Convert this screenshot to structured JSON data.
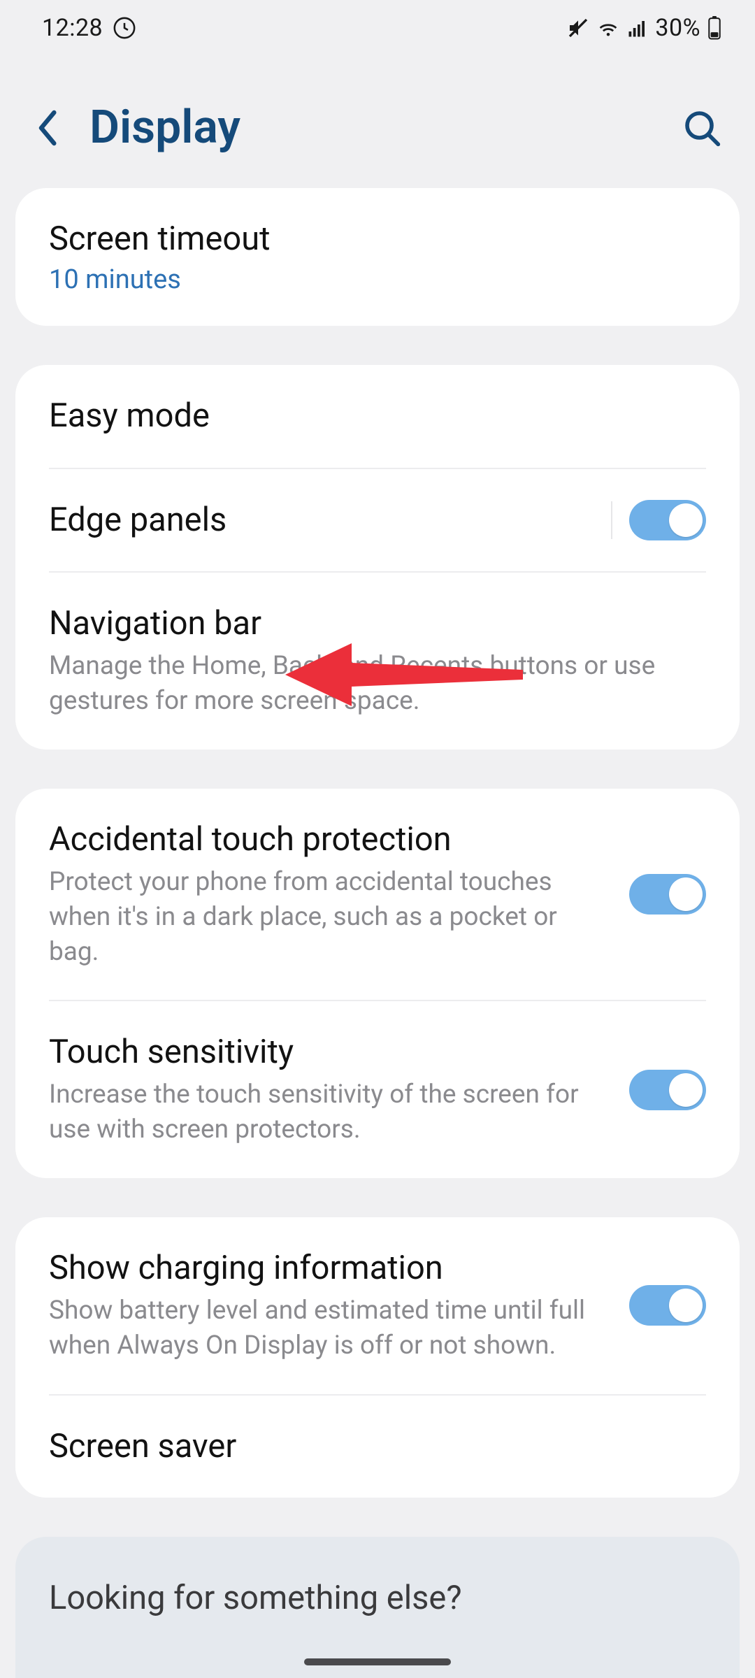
{
  "status": {
    "time": "12:28",
    "battery_text": "30%"
  },
  "header": {
    "title": "Display"
  },
  "group1": {
    "screen_timeout": {
      "title": "Screen timeout",
      "value": "10 minutes"
    }
  },
  "group2": {
    "easy_mode": {
      "title": "Easy mode"
    },
    "edge_panels": {
      "title": "Edge panels",
      "on": true
    },
    "navigation_bar": {
      "title": "Navigation bar",
      "sub": "Manage the Home, Back, and Recents buttons or use gestures for more screen space."
    }
  },
  "group3": {
    "accidental_touch": {
      "title": "Accidental touch protection",
      "sub": "Protect your phone from accidental touches when it's in a dark place, such as a pocket or bag.",
      "on": true
    },
    "touch_sensitivity": {
      "title": "Touch sensitivity",
      "sub": "Increase the touch sensitivity of the screen for use with screen protectors.",
      "on": true
    }
  },
  "group4": {
    "charging_info": {
      "title": "Show charging information",
      "sub": "Show battery level and estimated time until full when Always On Display is off or not shown.",
      "on": true
    },
    "screen_saver": {
      "title": "Screen saver"
    }
  },
  "footer": {
    "title": "Looking for something else?"
  },
  "colors": {
    "accent": "#154a7a",
    "link": "#2d71b4",
    "toggle_on": "#6fb0e8",
    "bg": "#f0f0f2",
    "card": "#ffffff",
    "subtext": "#8a8a8e",
    "annotation": "#eb2f3a"
  }
}
